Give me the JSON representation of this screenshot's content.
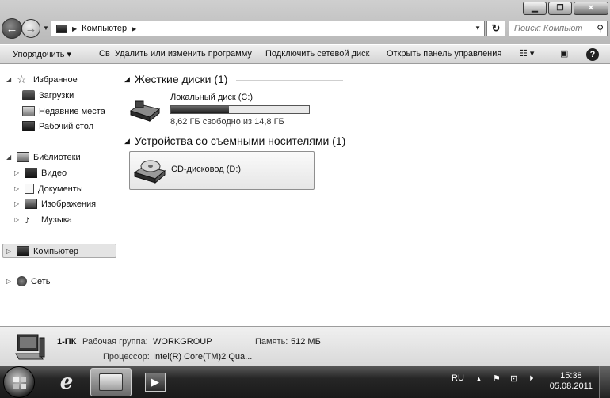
{
  "window": {
    "controls": {
      "minimize": "▁",
      "maximize": "❐",
      "close": "✕"
    }
  },
  "address": {
    "crumb": "Компьютер",
    "search_placeholder": "Поиск: Компьют"
  },
  "commands": {
    "organize": "Упорядочить",
    "properties_truncated": "Св",
    "uninstall": "Удалить или изменить программу",
    "map_drive": "Подключить сетевой диск",
    "control_panel": "Открыть панель управления"
  },
  "nav": {
    "favorites": "Избранное",
    "downloads": "Загрузки",
    "recent": "Недавние места",
    "desktop": "Рабочий стол",
    "libraries": "Библиотеки",
    "video": "Видео",
    "documents": "Документы",
    "pictures": "Изображения",
    "music": "Музыка",
    "computer": "Компьютер",
    "network": "Сеть"
  },
  "content": {
    "hdd_group": "Жесткие диски (1)",
    "removable_group": "Устройства со съемными носителями (1)",
    "local_disk": {
      "name": "Локальный диск (C:)",
      "space": "8,62 ГБ свободно из 14,8 ГБ",
      "used_fraction": 0.42
    },
    "cd_drive": "CD-дисковод (D:)"
  },
  "details": {
    "computer_name": "1-ПК",
    "workgroup_label": "Рабочая группа:",
    "workgroup_value": "WORKGROUP",
    "memory_label": "Память:",
    "memory_value": "512 МБ",
    "cpu_label": "Процессор:",
    "cpu_value": "Intel(R) Core(TM)2 Qua..."
  },
  "taskbar": {
    "language": "RU",
    "time": "15:38",
    "date": "05.08.2011"
  }
}
